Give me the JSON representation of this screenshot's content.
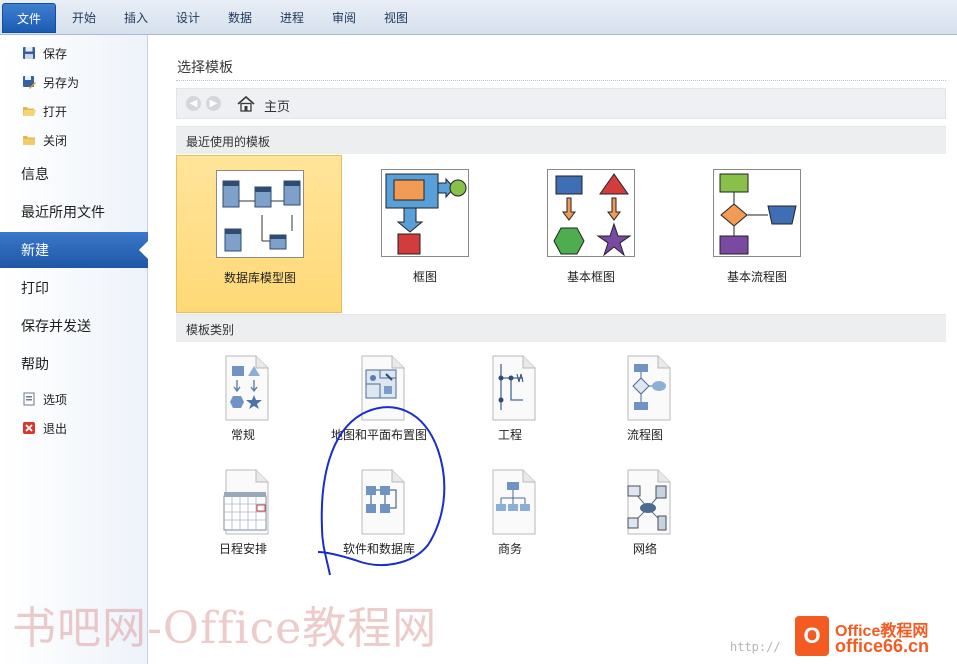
{
  "ribbon": {
    "tabs": [
      "文件",
      "开始",
      "插入",
      "设计",
      "数据",
      "进程",
      "审阅",
      "视图"
    ]
  },
  "nav": {
    "save": "保存",
    "save_as": "另存为",
    "open": "打开",
    "close": "关闭",
    "info": "信息",
    "recent": "最近所用文件",
    "new": "新建",
    "print": "打印",
    "save_send": "保存并发送",
    "help": "帮助",
    "options": "选项",
    "exit": "退出"
  },
  "main": {
    "title": "选择模板",
    "home": "主页",
    "recent_header": "最近使用的模板",
    "category_header": "模板类别",
    "recent_templates": [
      "数据库模型图",
      "框图",
      "基本框图",
      "基本流程图"
    ],
    "categories": [
      "常规",
      "地图和平面布置图",
      "工程",
      "流程图",
      "日程安排",
      "软件和数据库",
      "商务",
      "网络"
    ]
  },
  "watermark": {
    "text": "书吧网-Office教程网",
    "url": "http://",
    "logo_line1": "Office教程网",
    "logo_line2": "office66.cn",
    "logo_letter": "O"
  },
  "colors": {
    "accent": "#1f57a7",
    "selected_tile": "#ffd977",
    "annotation": "#1a2ccc"
  }
}
